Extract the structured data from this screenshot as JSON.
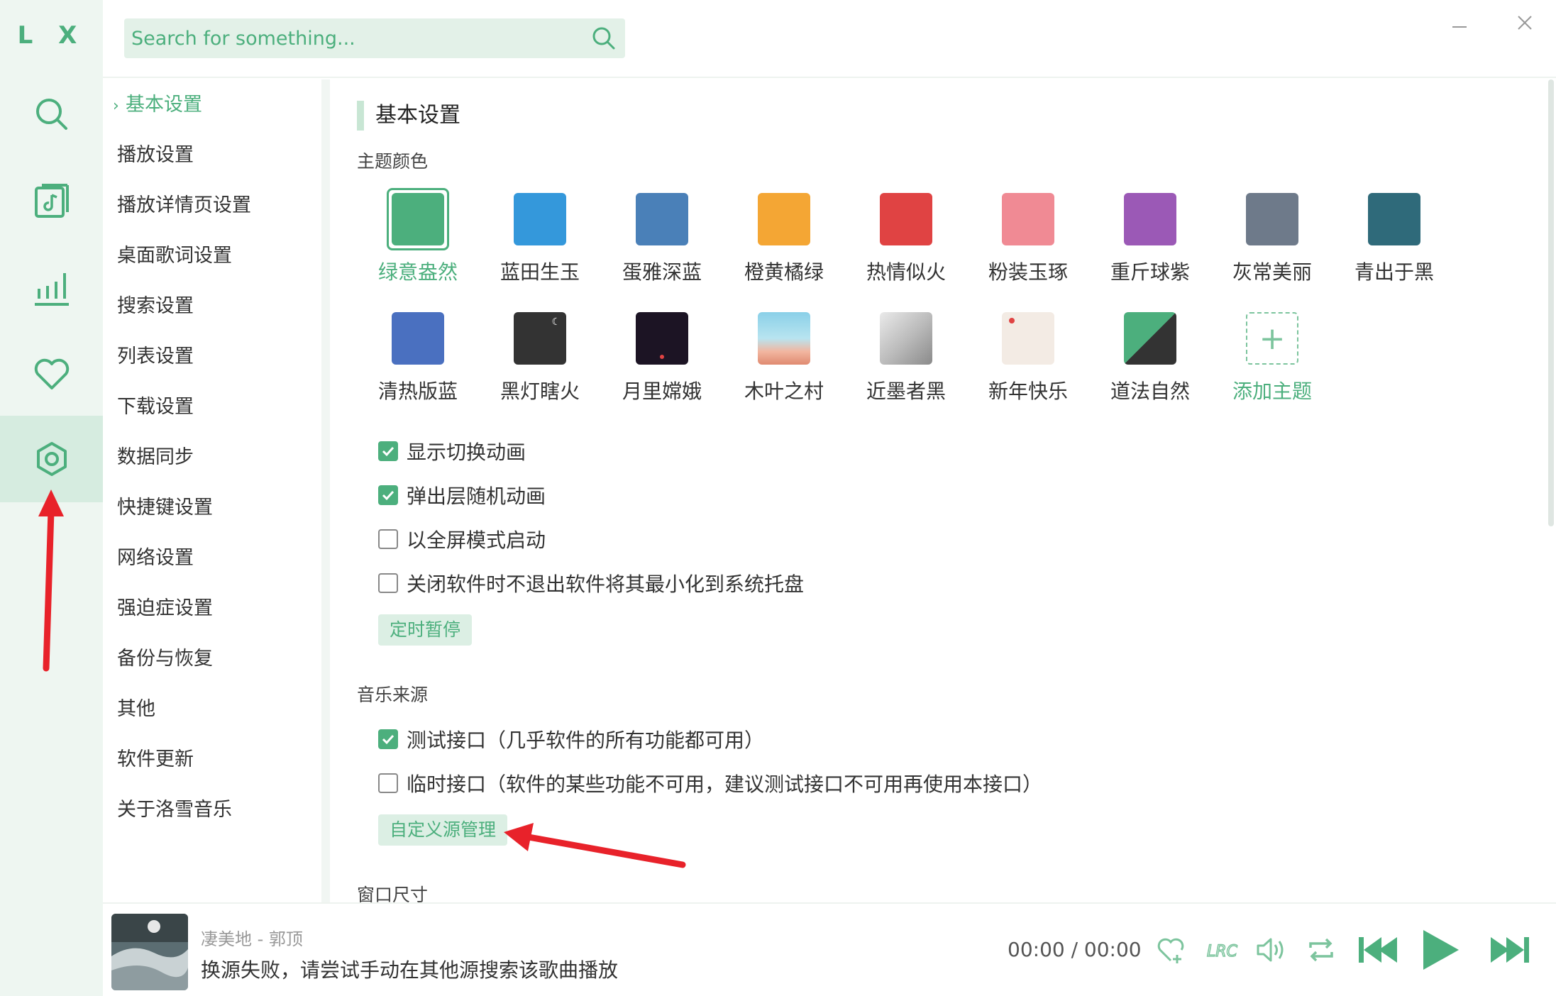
{
  "app": {
    "logo": "L X"
  },
  "search": {
    "placeholder": "Search for something..."
  },
  "nav": [
    {
      "name": "search-icon"
    },
    {
      "name": "song-list-icon"
    },
    {
      "name": "leaderboard-icon"
    },
    {
      "name": "favorites-icon"
    },
    {
      "name": "settings-icon",
      "active": true
    }
  ],
  "menu": {
    "items": [
      "基本设置",
      "播放设置",
      "播放详情页设置",
      "桌面歌词设置",
      "搜索设置",
      "列表设置",
      "下载设置",
      "数据同步",
      "快捷键设置",
      "网络设置",
      "强迫症设置",
      "备份与恢复",
      "其他",
      "软件更新",
      "关于洛雪音乐"
    ],
    "active_index": 0
  },
  "basic": {
    "title": "基本设置",
    "theme_label": "主题颜色",
    "themes_row1": [
      {
        "name": "绿意盎然",
        "color": "#4caf7d",
        "active": true
      },
      {
        "name": "蓝田生玉",
        "color": "#3498db"
      },
      {
        "name": "蛋雅深蓝",
        "color": "#4a80b8"
      },
      {
        "name": "橙黄橘绿",
        "color": "#f4a634"
      },
      {
        "name": "热情似火",
        "color": "#e04343"
      },
      {
        "name": "粉装玉琢",
        "color": "#f08a94"
      },
      {
        "name": "重斤球紫",
        "color": "#9b59b6"
      },
      {
        "name": "灰常美丽",
        "color": "#6e7a8a"
      },
      {
        "name": "青出于黑",
        "color": "#2f6a7a"
      }
    ],
    "themes_row2": [
      {
        "name": "清热版蓝",
        "color": "#4a70c0"
      },
      {
        "name": "黑灯瞎火",
        "color": "#333333"
      },
      {
        "name": "月里嫦娥",
        "color": "#1c1424"
      },
      {
        "name": "木叶之村",
        "color": "#8ad0e8"
      },
      {
        "name": "近墨者黑",
        "color": "#c9c9c9"
      },
      {
        "name": "新年快乐",
        "color": "#f3ebe4"
      },
      {
        "name": "道法自然",
        "color": "#4caf7d"
      }
    ],
    "add_theme": "添加主题",
    "checks": [
      {
        "label": "显示切换动画",
        "checked": true
      },
      {
        "label": "弹出层随机动画",
        "checked": true
      },
      {
        "label": "以全屏模式启动",
        "checked": false
      },
      {
        "label": "关闭软件时不退出软件将其最小化到系统托盘",
        "checked": false
      }
    ],
    "timer_button": "定时暂停",
    "source_label": "音乐来源",
    "sources": [
      {
        "label": "测试接口（几乎软件的所有功能都可用）",
        "checked": true
      },
      {
        "label": "临时接口（软件的某些功能不可用，建议测试接口不可用再使用本接口）",
        "checked": false
      }
    ],
    "custom_source_button": "自定义源管理",
    "window_size_label": "窗口尺寸"
  },
  "player": {
    "song": "凄美地 - 郭顶",
    "message": "换源失败，请尝试手动在其他源搜索该歌曲播放",
    "time": "00:00  /  00:00",
    "accent": "#4caf7d"
  }
}
